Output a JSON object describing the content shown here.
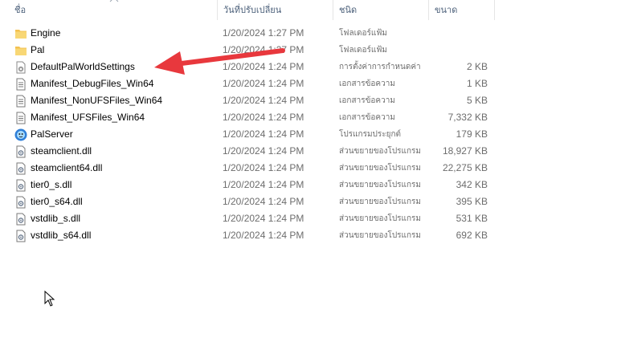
{
  "columns": {
    "name": "ชื่อ",
    "date": "วันที่ปรับเปลี่ยน",
    "type": "ชนิด",
    "size": "ขนาด"
  },
  "files": [
    {
      "icon": "folder-icon",
      "name": "Engine",
      "date": "1/20/2024 1:27 PM",
      "type": "โฟลเดอร์แฟ้ม",
      "size": ""
    },
    {
      "icon": "folder-icon",
      "name": "Pal",
      "date": "1/20/2024 1:27 PM",
      "type": "โฟลเดอร์แฟ้ม",
      "size": ""
    },
    {
      "icon": "settings-file-icon",
      "name": "DefaultPalWorldSettings",
      "date": "1/20/2024 1:24 PM",
      "type": "การตั้งค่าการกำหนดค่า",
      "size": "2 KB"
    },
    {
      "icon": "text-document-icon",
      "name": "Manifest_DebugFiles_Win64",
      "date": "1/20/2024 1:24 PM",
      "type": "เอกสารข้อความ",
      "size": "1 KB"
    },
    {
      "icon": "text-document-icon",
      "name": "Manifest_NonUFSFiles_Win64",
      "date": "1/20/2024 1:24 PM",
      "type": "เอกสารข้อความ",
      "size": "5 KB"
    },
    {
      "icon": "text-document-icon",
      "name": "Manifest_UFSFiles_Win64",
      "date": "1/20/2024 1:24 PM",
      "type": "เอกสารข้อความ",
      "size": "7,332 KB"
    },
    {
      "icon": "palserver-app-icon",
      "name": "PalServer",
      "date": "1/20/2024 1:24 PM",
      "type": "โปรแกรมประยุกต์",
      "size": "179 KB"
    },
    {
      "icon": "dll-file-icon",
      "name": "steamclient.dll",
      "date": "1/20/2024 1:24 PM",
      "type": "ส่วนขยายของโปรแกรม",
      "size": "18,927 KB"
    },
    {
      "icon": "dll-file-icon",
      "name": "steamclient64.dll",
      "date": "1/20/2024 1:24 PM",
      "type": "ส่วนขยายของโปรแกรม",
      "size": "22,275 KB"
    },
    {
      "icon": "dll-file-icon",
      "name": "tier0_s.dll",
      "date": "1/20/2024 1:24 PM",
      "type": "ส่วนขยายของโปรแกรม",
      "size": "342 KB"
    },
    {
      "icon": "dll-file-icon",
      "name": "tier0_s64.dll",
      "date": "1/20/2024 1:24 PM",
      "type": "ส่วนขยายของโปรแกรม",
      "size": "395 KB"
    },
    {
      "icon": "dll-file-icon",
      "name": "vstdlib_s.dll",
      "date": "1/20/2024 1:24 PM",
      "type": "ส่วนขยายของโปรแกรม",
      "size": "531 KB"
    },
    {
      "icon": "dll-file-icon",
      "name": "vstdlib_s64.dll",
      "date": "1/20/2024 1:24 PM",
      "type": "ส่วนขยายของโปรแกรม",
      "size": "692 KB"
    }
  ],
  "colors": {
    "arrow": "#e8383d",
    "folder": "#f3c150",
    "header_text": "#4c607a"
  }
}
